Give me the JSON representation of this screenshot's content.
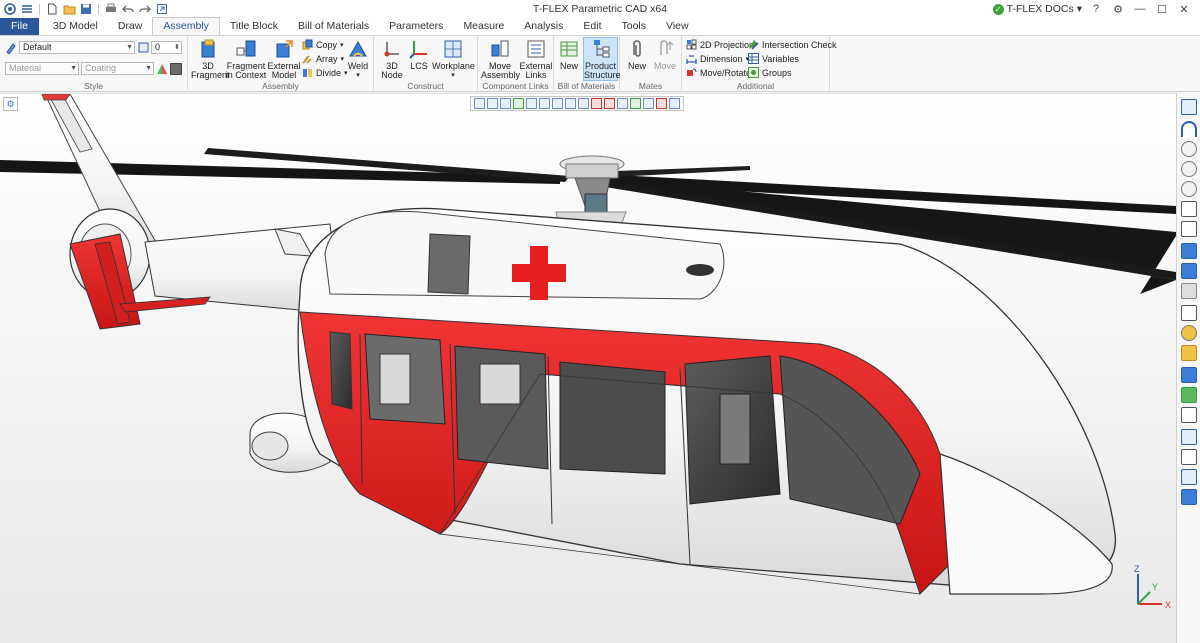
{
  "app": {
    "title": "T-FLEX Parametric CAD x64",
    "docs_label": "T-FLEX DOCs",
    "docs_dropdown": "▾"
  },
  "window_controls": {
    "help": "?",
    "settings": "⚙",
    "minimize": "—",
    "restore": "☐",
    "close": "✕"
  },
  "quick_access": [
    "app-menu-icon",
    "new-document-icon",
    "open-icon",
    "save-icon",
    "print-icon",
    "undo-icon",
    "redo-icon",
    "export-icon"
  ],
  "tabs": [
    {
      "label": "File"
    },
    {
      "label": "3D Model"
    },
    {
      "label": "Draw"
    },
    {
      "label": "Assembly"
    },
    {
      "label": "Title Block"
    },
    {
      "label": "Bill of Materials"
    },
    {
      "label": "Parameters"
    },
    {
      "label": "Measure"
    },
    {
      "label": "Analysis"
    },
    {
      "label": "Edit"
    },
    {
      "label": "Tools"
    },
    {
      "label": "View"
    }
  ],
  "active_tab": "Assembly",
  "ribbon": {
    "style": {
      "label": "Style",
      "layer_value": "Default",
      "line_value": "0",
      "material_placeholder": "Material",
      "coating_placeholder": "Coating"
    },
    "assembly": {
      "label": "Assembly",
      "fragment3d": [
        "3D",
        "Fragment"
      ],
      "fragment_in_context": [
        "Fragment",
        "in Context"
      ],
      "external_model": [
        "External",
        "Model"
      ],
      "copy": "Copy",
      "array": "Array",
      "divide": "Divide",
      "weld": "Weld"
    },
    "construct": {
      "label": "Construct",
      "node3d": [
        "3D",
        "Node"
      ],
      "lcs": "LCS",
      "workplane": "Workplane"
    },
    "component_links": {
      "label": "Component Links",
      "move_assembly": [
        "Move",
        "Assembly"
      ],
      "external_links": [
        "External",
        "Links"
      ]
    },
    "bill_of_materials": {
      "label": "Bill of Materials",
      "new": "New",
      "product_structure": [
        "Product",
        "Structure"
      ]
    },
    "mates": {
      "label": "Mates",
      "new": "New",
      "move": "Move"
    },
    "additional": {
      "label": "Additional",
      "projection2d": "2D Projection",
      "dimension": "Dimension",
      "move_rotate": "Move/Rotate",
      "intersection_check": "Intersection Check",
      "variables": "Variables",
      "groups": "Groups"
    }
  },
  "axis_labels": {
    "x": "X",
    "y": "Y",
    "z": "Z"
  },
  "colors": {
    "accent": "#2b579a",
    "livery_red": "#e51f1f",
    "body_white": "#fafafa",
    "rotor_black": "#151515"
  }
}
